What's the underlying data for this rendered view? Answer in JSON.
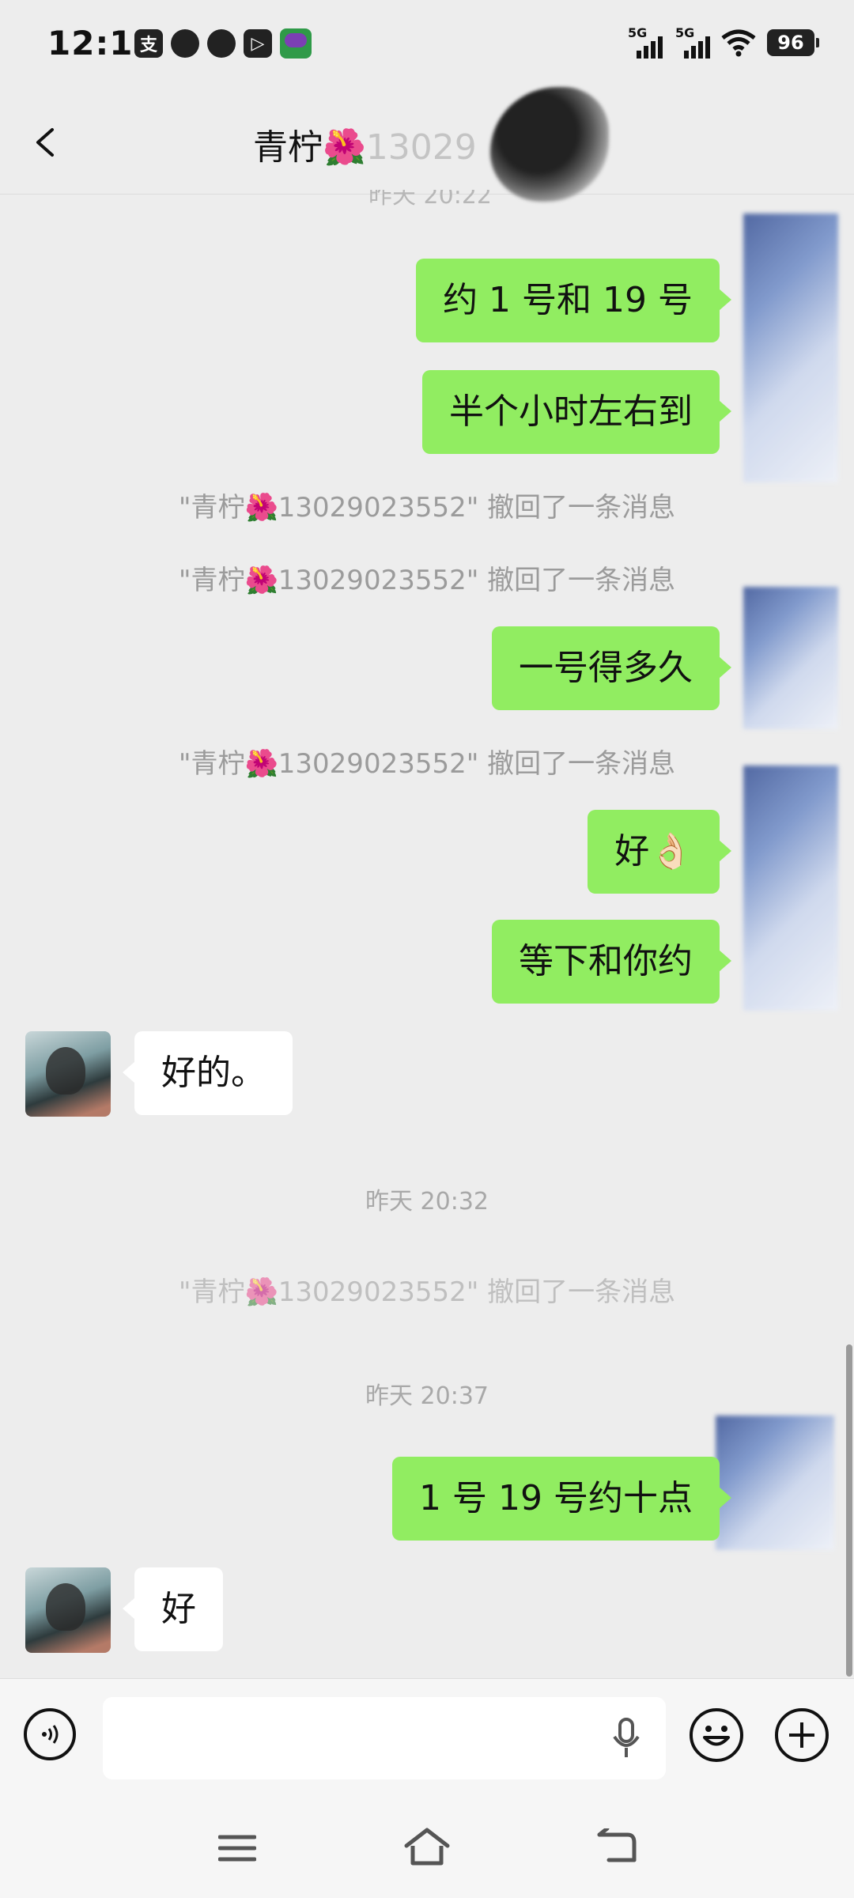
{
  "status_bar": {
    "time": "12:16",
    "left_icons": [
      "alipay-icon",
      "quark-icon",
      "qq-icon",
      "video-icon",
      "game-app-icon"
    ],
    "signal_1_label": "5G",
    "signal_2_label": "5G",
    "battery": "96"
  },
  "header": {
    "title_name": "青柠",
    "title_flower": "🌺",
    "title_number_faded": "13029"
  },
  "messages": {
    "timestamp_top": "昨天 20:22",
    "m1": "约 1 号和 19 号",
    "m2": "半个小时左右到",
    "recall1": "\"青柠🌺13029023552\" 撤回了一条消息",
    "recall2": "\"青柠🌺13029023552\" 撤回了一条消息",
    "m3": "一号得多久",
    "recall3": "\"青柠🌺13029023552\" 撤回了一条消息",
    "m4": "好👌🏻",
    "m5": "等下和你约",
    "t1": "好的。",
    "timestamp2": "昨天 20:32",
    "recall4": "\"青柠🌺13029023552\" 撤回了一条消息",
    "timestamp3": "昨天 20:37",
    "m6": "1 号 19 号约十点",
    "t2": "好"
  },
  "input": {
    "placeholder": ""
  },
  "colors": {
    "my_bubble": "#91ed61",
    "their_bubble": "#ffffff",
    "background": "#ededed"
  }
}
